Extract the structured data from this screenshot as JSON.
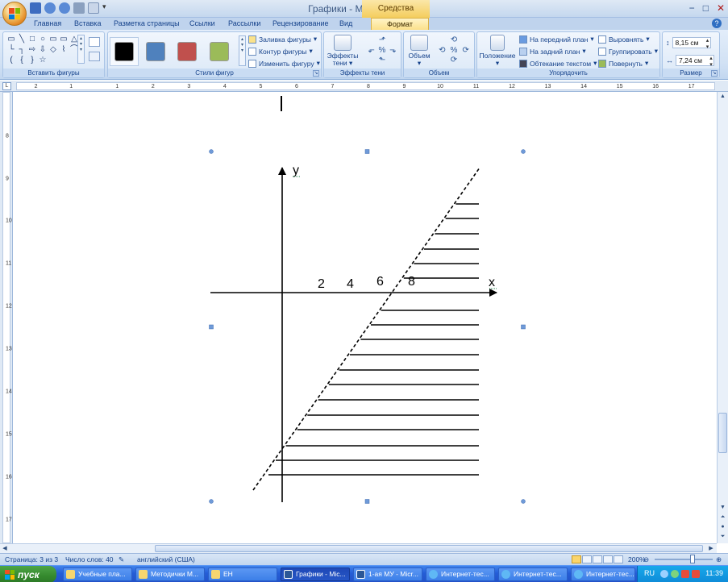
{
  "window": {
    "title": "Графики - Microsoft Word",
    "contextual_tab_title": "Средства рисования",
    "controls": [
      "−",
      "□",
      "✕"
    ]
  },
  "ribbon_tabs": [
    "Главная",
    "Вставка",
    "Разметка страницы",
    "Ссылки",
    "Рассылки",
    "Рецензирование",
    "Вид",
    "Формат"
  ],
  "active_tab": "Формат",
  "ribbon": {
    "insert_shapes": {
      "label": "Вставить фигуры",
      "shapes": [
        "▭",
        "╲",
        "□",
        "○",
        "▭",
        "▭",
        "△",
        "└",
        "┐",
        "⇨",
        "⇩",
        "◇",
        "⌇",
        "⌒",
        "(",
        "{",
        "}",
        "☆",
        "⌐",
        "⌜",
        "⌝"
      ]
    },
    "shape_styles": {
      "label": "Стили фигур",
      "swatches": [
        "#000000",
        "#4f81bd",
        "#c0504d",
        "#9bbb59"
      ],
      "fill": "Заливка фигуры",
      "outline": "Контур фигуры",
      "change": "Изменить фигуру"
    },
    "shadow_effects": {
      "label": "Эффекты тени",
      "button": "Эффекты тени"
    },
    "volume": {
      "label": "Объем",
      "button": "Объем"
    },
    "arrange": {
      "label": "Упорядочить",
      "position": "Положение",
      "bring_front": "На передний план",
      "send_back": "На задний план",
      "text_wrap": "Обтекание текстом",
      "align": "Выровнять",
      "group": "Группировать",
      "rotate": "Повернуть"
    },
    "size": {
      "label": "Размер",
      "height": "8,15 см",
      "width": "7,24 см"
    }
  },
  "ruler": {
    "top_numbers": [
      "2",
      "1",
      "1",
      "2",
      "3",
      "4",
      "5",
      "6",
      "7",
      "8",
      "9",
      "10",
      "11",
      "12",
      "13",
      "14",
      "15",
      "16",
      "17"
    ],
    "left_numbers": [
      "8",
      "9",
      "10",
      "11",
      "12",
      "13",
      "14",
      "15",
      "16",
      "17"
    ]
  },
  "graph": {
    "y_label": "y",
    "x_label": "x",
    "tick_labels": [
      "2",
      "4",
      "6",
      "8"
    ]
  },
  "status": {
    "page": "Страница: 3 из 3",
    "words": "Число слов: 40",
    "language": "английский (США)",
    "zoom": "200%"
  },
  "taskbar": {
    "start": "пуск",
    "tasks": [
      "Учебные пла...",
      "Методички М...",
      "ЕН",
      "Графики - Mic...",
      "1-ая МУ - Micr...",
      "Интернет-тес...",
      "Интернет-тес...",
      "Интернет-тес..."
    ],
    "active_task": "Графики - Mic...",
    "language": "RU",
    "clock": "11:39"
  }
}
